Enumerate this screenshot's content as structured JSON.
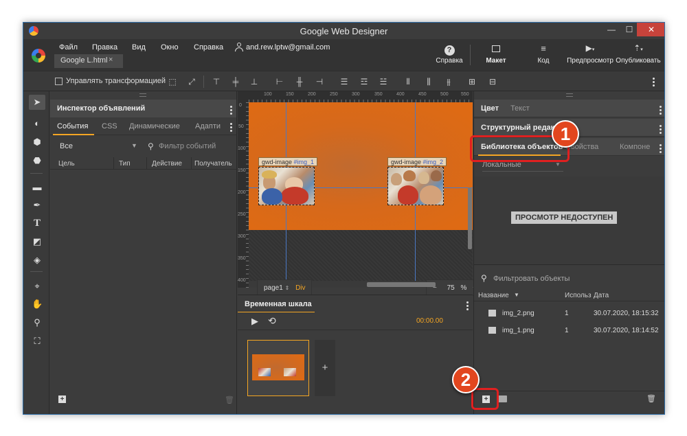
{
  "window": {
    "title": "Google Web Designer",
    "min": "—",
    "max": "☐",
    "close": "✕"
  },
  "menu": {
    "items": [
      "Файл",
      "Правка",
      "Вид",
      "Окно",
      "Справка"
    ],
    "user_email": "and.rew.lptw@gmail.com",
    "doc_tab": "Google L.html",
    "doc_tab_close": "×"
  },
  "top_buttons": {
    "help": "Справка",
    "layout": "Макет",
    "code": "Код",
    "preview": "Предпросмотр",
    "publish": "Опубликовать"
  },
  "toolbar": {
    "transform_label": "Управлять трансформацией"
  },
  "left_panel": {
    "title": "Инспектор объявлений",
    "tabs": [
      "События",
      "CSS",
      "Динамические",
      "Адапти"
    ],
    "filter_select": "Все",
    "filter_placeholder": "Фильтр событий",
    "columns": [
      "Цель",
      "Тип",
      "Действие",
      "Получатель"
    ]
  },
  "stage": {
    "ruler_top": [
      "100",
      "150",
      "200",
      "250",
      "300",
      "350",
      "400",
      "450",
      "500",
      "550"
    ],
    "ruler_left": [
      "0",
      "50",
      "100",
      "150",
      "200",
      "250",
      "300",
      "350",
      "400"
    ],
    "img1_label_type": "gwd-image",
    "img1_label_id": "#img_1",
    "img2_label_type": "gwd-image",
    "img2_label_id": "#img_2",
    "page_name": "page1",
    "page_element": "Div",
    "zoom_minus": "−",
    "zoom_value": "75",
    "zoom_unit": "%",
    "zoom_plus": "+"
  },
  "timeline": {
    "title": "Временная шкала",
    "time": "00:00.00",
    "add_label": "+"
  },
  "right_panel": {
    "color_tab": "Цвет",
    "text_tab": "Текст",
    "structure_title": "Структурный редактор",
    "library_title": "Библиотека объектов",
    "properties_tab": "Свойства",
    "components_tab": "Компоне",
    "source_select": "Локальные",
    "preview_unavailable": "ПРОСМОТР НЕДОСТУПЕН",
    "filter_placeholder": "Фильтровать объекты",
    "columns": {
      "name": "Название",
      "usage": "Использ",
      "date": "Дата"
    },
    "assets": [
      {
        "name": "img_2.png",
        "usage": "1",
        "date": "30.07.2020, 18:15:32"
      },
      {
        "name": "img_1.png",
        "usage": "1",
        "date": "30.07.2020, 18:14:52"
      }
    ]
  },
  "annotations": {
    "badge1": "1",
    "badge2": "2"
  },
  "colors": {
    "accent_orange": "#f5a623",
    "stage_orange": "#d6691b",
    "callout_red": "#e02020",
    "badge_orange": "#e2461e"
  }
}
